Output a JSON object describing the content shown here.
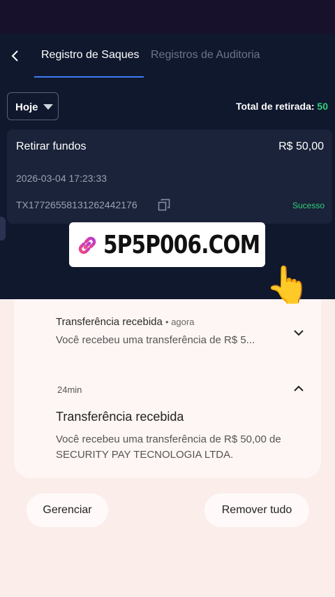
{
  "header": {
    "tabs": [
      {
        "label": "Registro de Saques",
        "active": true
      },
      {
        "label": "Registros de Auditoria",
        "active": false
      }
    ]
  },
  "filter": {
    "selected": "Hoje",
    "total_label": "Total de retirada:",
    "total_value": "50"
  },
  "withdrawal": {
    "title": "Retirar fundos",
    "amount": "R$ 50,00",
    "datetime": "2026-03-04 17:23:33",
    "tx_id": "TX17726558131262442176",
    "status": "Sucesso"
  },
  "banner": {
    "text": "5P5P006.COM"
  },
  "notifications": {
    "collapsed": {
      "title": "Transferência recebida",
      "time": "agora",
      "body": "Você recebeu uma transferência de R$ 5..."
    },
    "expanded": {
      "time": "24min",
      "title": "Transferência recebida",
      "body": "Você recebeu uma transferência de R$ 50,00 de SECURITY PAY TECNOLOGIA LTDA."
    }
  },
  "actions": {
    "manage": "Gerenciar",
    "clear_all": "Remover tudo"
  },
  "colors": {
    "app_bg": "#10182e",
    "accent": "#3d7cf3",
    "success": "#2fd07a",
    "notification_bg": "#fbeeea"
  }
}
